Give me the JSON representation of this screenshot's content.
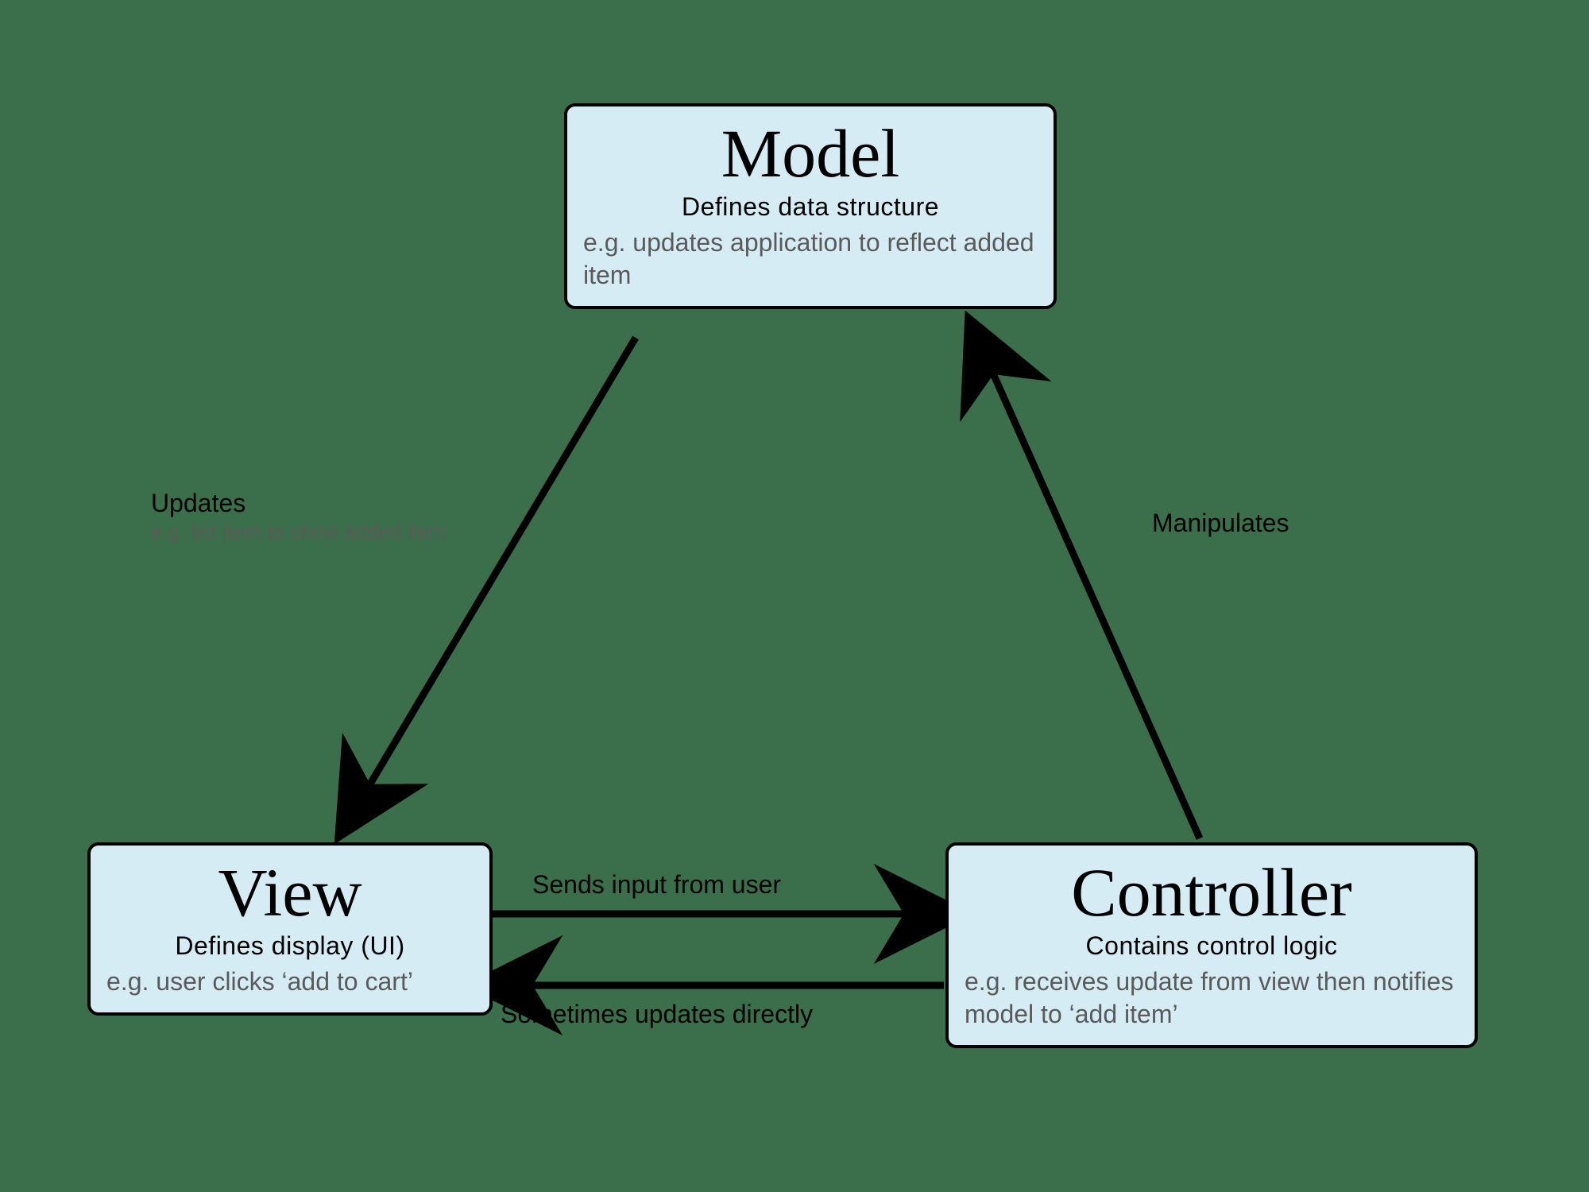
{
  "nodes": {
    "model": {
      "title": "Model",
      "subtitle": "Defines data structure",
      "example": "e.g. updates application to reflect added item"
    },
    "view": {
      "title": "View",
      "subtitle": "Defines display (UI)",
      "example": "e.g. user clicks ‘add to cart’"
    },
    "controller": {
      "title": "Controller",
      "subtitle": "Contains control logic",
      "example": "e.g. receives update from view then notifies model to ‘add item’"
    }
  },
  "edges": {
    "model_to_view": {
      "label": "Updates",
      "sub": "e.g. list item to show added item"
    },
    "controller_to_model": {
      "label": "Manipulates"
    },
    "view_to_controller": {
      "label": "Sends input from user"
    },
    "controller_to_view": {
      "label": "Sometimes updates directly"
    }
  },
  "colors": {
    "background": "#3b6e4b",
    "box_fill": "#d5ecf4",
    "stroke": "#000000",
    "muted": "#5a5a5a"
  }
}
